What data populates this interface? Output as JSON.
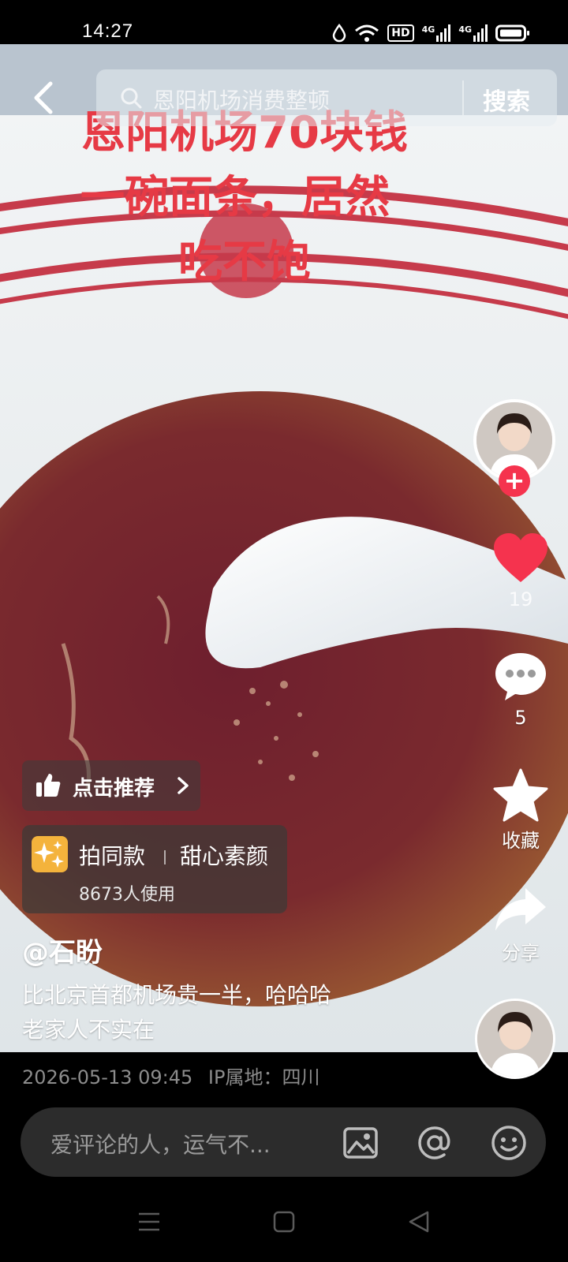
{
  "status_bar": {
    "time": "14:27",
    "icons": [
      "water-drop-icon",
      "wifi-icon",
      "hd-icon",
      "signal-4g-icon",
      "signal-4g-icon",
      "battery-icon"
    ],
    "hd_label": "HD",
    "net_label": "4G"
  },
  "search": {
    "placeholder": "恩阳机场消费整顿",
    "button_label": "搜索"
  },
  "headline": {
    "line1": "恩阳机场70块钱",
    "line2": "一碗面条，居然",
    "line3": "吃不饱"
  },
  "rail": {
    "like_count": "19",
    "comment_count": "5",
    "favorite_label": "收藏",
    "share_label": "分享"
  },
  "recommend": {
    "label": "点击推荐"
  },
  "effect": {
    "title": "拍同款",
    "name": "甜心素颜",
    "usage": "8673人使用"
  },
  "post": {
    "author": "@石盼",
    "desc_line1": "比北京首都机场贵一半，哈哈哈",
    "desc_line2": "老家人不实在",
    "datetime": "2026-05-13 09:45",
    "ip_location": "IP属地：四川"
  },
  "comment": {
    "placeholder": "爱评论的人，运气不..."
  },
  "colors": {
    "headline_red": "#e63a45",
    "like_red": "#f5334e",
    "effect_badge": "#f4b33c"
  }
}
